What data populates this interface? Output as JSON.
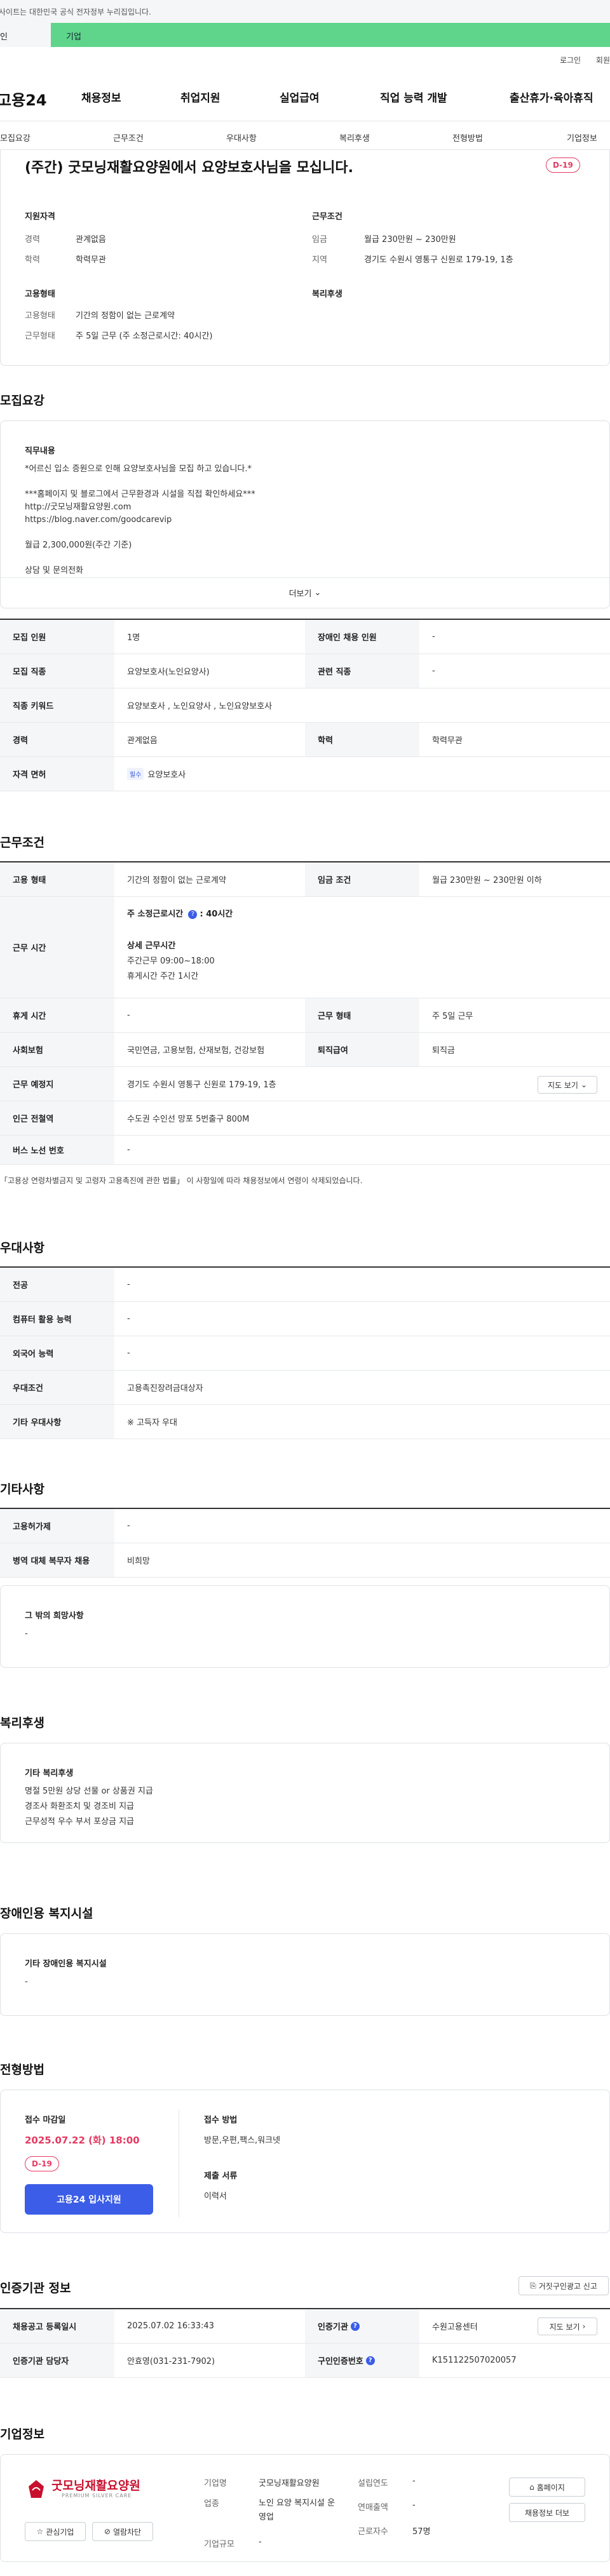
{
  "gov_bar": {
    "text": "사이트는 대한민국 공식 전자정부 누리집입니다."
  },
  "top_tabs": [
    "인",
    "기업"
  ],
  "util_links": [
    "로그인",
    "회원"
  ],
  "logo": "고용24",
  "gnb": [
    "채용정보",
    "취업지원",
    "실업급여",
    "직업 능력 개발",
    "출산휴가·육아휴직"
  ],
  "subnav": [
    "모집요강",
    "근무조건",
    "우대사항",
    "복리후생",
    "전형방법",
    "기업정보"
  ],
  "summary": {
    "title": "(주간) 굿모닝재활요양원에서 요양보호사님을 모십니다.",
    "dday": "D-19",
    "qual_title": "지원자격",
    "qual": [
      {
        "k": "경력",
        "v": "관계없음"
      },
      {
        "k": "학력",
        "v": "학력무관"
      }
    ],
    "cond_title": "근무조건",
    "cond": [
      {
        "k": "임금",
        "v": "월급 230만원 ~ 230만원"
      },
      {
        "k": "지역",
        "v": "경기도 수원시 영통구 신원로 179-19, 1층"
      }
    ],
    "emp_title": "고용형태",
    "emp": [
      {
        "k": "고용형태",
        "v": "기간의 정함이 없는 근로계약"
      },
      {
        "k": "근무형태",
        "v": "주 5일 근무 (주 소정근로시간: 40시간)"
      }
    ],
    "welfare_title": "복리후생"
  },
  "recruit": {
    "heading": "모집요강",
    "box_label": "직무내용",
    "lines": [
      "*어르신 입소 증원으로 인해 요양보호사님을 모집 하고 있습니다.*",
      "",
      "***홈페이지 및 블로그에서 근무환경과 시설을 직접 확인하세요***",
      "http://굿모닝재활요양원.com",
      "https://blog.naver.com/goodcarevip",
      "",
      "월급 2,300,000원(주간 기준)",
      "",
      "상담 및 문의전화"
    ],
    "more": "더보기",
    "rows": [
      {
        "l1": "모집 인원",
        "v1": "1명",
        "l2": "장애인 채용 인원",
        "v2": "-"
      },
      {
        "l1": "모집 직종",
        "v1": "요양보호사(노인요양사)",
        "l2": "관련 직종",
        "v2": "-"
      },
      {
        "l1": "직종 키워드",
        "v1": "요양보호사 , 노인요양사 , 노인요양보호사"
      },
      {
        "l1": "경력",
        "v1": "관계없음",
        "l2": "학력",
        "v2": "학력무관"
      },
      {
        "l1": "자격 면허",
        "chip": "필수",
        "v1": "요양보호사"
      }
    ]
  },
  "conditions": {
    "heading": "근무조건",
    "r1": {
      "l1": "고용 형태",
      "v1": "기간의 정함이 없는 근로계약",
      "l2": "임금 조건",
      "v2": "월급 230만원 ~ 230만원 이하"
    },
    "hours": {
      "label": "근무 시간",
      "weekly": "주 소정근로시간",
      "weekly_val": ": 40시간",
      "detail_title": "상세 근무시간",
      "detail1": "주간근무 09:00~18:00",
      "detail2": "휴게시간 주간 1시간"
    },
    "r3": {
      "l1": "휴게 시간",
      "v1": "-",
      "l2": "근무 형태",
      "v2": "주 5일 근무"
    },
    "r4": {
      "l1": "사회보험",
      "v1": "국민연금, 고용보험, 산재보험, 건강보험",
      "l2": "퇴직급여",
      "v2": "퇴직금"
    },
    "r5": {
      "l1": "근무 예정지",
      "v1": "경기도 수원시 영통구 신원로 179-19, 1층",
      "btn": "지도 보기"
    },
    "r6": {
      "l1": "인근 전철역",
      "v1": "수도권 수인선 망포 5번출구 800M"
    },
    "r7": {
      "l1": "버스 노선 번호",
      "v1": "-"
    },
    "note": "「고용상 연령차별금지 및 고령자 고용촉진에 관한 법률」 이 사항일에 따라 채용정보에서 연령이 삭제되었습니다."
  },
  "pref": {
    "heading": "우대사항",
    "rows": [
      {
        "l": "전공",
        "v": "-"
      },
      {
        "l": "컴퓨터 활용 능력",
        "v": "-"
      },
      {
        "l": "외국어 능력",
        "v": "-"
      },
      {
        "l": "우대조건",
        "v": "고용촉진장려금대상자"
      },
      {
        "l": "기타 우대사항",
        "v": "※ 고득자 우대"
      }
    ]
  },
  "etc": {
    "heading": "기타사항",
    "rows": [
      {
        "l": "고용허가제",
        "v": "-"
      },
      {
        "l": "병역 대체 복무자 채용",
        "v": "비희망"
      }
    ],
    "box_label": "그 밖의 희망사항",
    "box_value": "-"
  },
  "welfare": {
    "heading": "복리후생",
    "box_label": "기타 복리후생",
    "lines": [
      "명절 5만원 상당 선물 or 상품권 지급",
      "경조사 화환조치 및 경조비 지급",
      "근무성적 우수 부서 포상금 지급"
    ]
  },
  "disability": {
    "heading": "장애인용 복지시설",
    "box_label": "기타 장애인용 복지시설",
    "box_value": "-"
  },
  "process": {
    "heading": "전형방법",
    "deadline_label": "접수 마감일",
    "deadline": "2025.07.22 (화) 18:00",
    "dday": "D-19",
    "apply": "고용24 입사지원",
    "method_label": "접수 방법",
    "method": "방문,우편,팩스,워크넷",
    "docs_label": "제출 서류",
    "docs": "이력서"
  },
  "cert": {
    "heading": "인증기관 정보",
    "report_btn": "거짓구인광고 신고",
    "rows": [
      {
        "l1": "채용공고 등록일시",
        "v1": "2025.07.02 16:33:43",
        "l2": "인증기관",
        "v2": "수원고용센터",
        "btn": "지도 보기"
      },
      {
        "l1": "인증기관 담당자",
        "v1": "안효영(031-231-7902)",
        "l2": "구인인증번호",
        "v2": "K151122507020057"
      }
    ]
  },
  "company": {
    "heading": "기업정보",
    "logo_text": "굿모닝재활요양원",
    "logo_sub": "PREMIUM SILVER CARE",
    "fav_btn": "관심기업",
    "block_btn": "열람차단",
    "fields": [
      {
        "k": "기업명",
        "v": "굿모닝재활요양원"
      },
      {
        "k": "업종",
        "v": "노인 요양 복지시설 운영업"
      },
      {
        "k": "기업규모",
        "v": "-"
      }
    ],
    "fields2": [
      {
        "k": "설립연도",
        "v": "-"
      },
      {
        "k": "연매출액",
        "v": "-"
      },
      {
        "k": "근로자수",
        "v": "57명"
      }
    ],
    "home_btn": "홈페이지",
    "jobs_btn": "채용정보 더보"
  },
  "colors": {
    "accent": "#3b5de7",
    "dday": "#e53961",
    "top_green": "#5fd58b"
  }
}
